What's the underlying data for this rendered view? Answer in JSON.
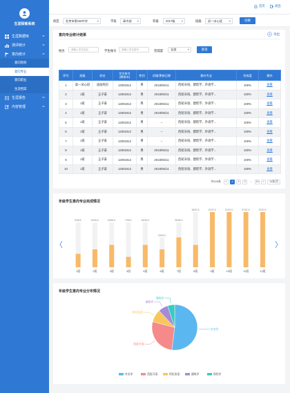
{
  "sidebar": {
    "title": "生涯探索系统",
    "menu": [
      {
        "label": "生涯数据库"
      },
      {
        "label": "测评统计"
      },
      {
        "label": "意向统计"
      }
    ],
    "submenu": [
      {
        "label": "意向院校"
      },
      {
        "label": "意向专业"
      },
      {
        "label": "意向职业"
      },
      {
        "label": "生涯档案"
      }
    ],
    "menu_bottom": [
      {
        "label": "生涯报告"
      },
      {
        "label": "内容管理"
      }
    ]
  },
  "topbar": {
    "home": "首页",
    "logout": "退出"
  },
  "filters": {
    "school_label": "校区",
    "school_value": "北京市第166中学",
    "section_label": "学段",
    "section_value": "高中部",
    "grade_label": "年级",
    "grade_value": "2017级",
    "class_label": "班级",
    "class_value": "初一冰心班",
    "switch_btn": "切换"
  },
  "table_card": {
    "title": "意向专业统计结果",
    "export": "导出",
    "name_label": "姓名",
    "name_placeholder": "请输入学生姓名",
    "id_label": "学生账号",
    "id_placeholder": "请输入学生账号",
    "status_label": "完成度",
    "status_value": "全部",
    "query_btn": "查询",
    "headers": [
      "序号",
      "班级",
      "姓名",
      "学生账号\n(教育ID)",
      "性别",
      "初填/更新日期",
      "意向专业",
      "完成度",
      "操作"
    ],
    "rows": [
      [
        "1",
        "高一冰心班",
        "迪丽热巴",
        "12001812",
        "男",
        "2018/05/11",
        "西班牙语、建筑学、外语学...",
        "100%",
        "查看"
      ],
      [
        "2",
        "1班",
        "王子安",
        "12001812",
        "男",
        "2018/05/11",
        "西班牙语、建筑学、外语学...",
        "100%",
        "查看"
      ],
      [
        "3",
        "1班",
        "王子安",
        "12001812",
        "男",
        "2018/05/11",
        "西班牙语、建筑学、外语学...",
        "100%",
        "查看"
      ],
      [
        "4",
        "1班",
        "王子安",
        "12001812",
        "男",
        "2018/05/11",
        "西班牙语、建筑学、外语学...",
        "100%",
        "查看"
      ],
      [
        "5",
        "1班",
        "王子安",
        "12001812",
        "男",
        "--",
        "西班牙语、建筑学、外语学...",
        "100%",
        "查看"
      ],
      [
        "6",
        "1班",
        "王子安",
        "12001812",
        "男",
        "--",
        "西班牙语、建筑学、外语学...",
        "100%",
        "查看"
      ],
      [
        "7",
        "1班",
        "王子安",
        "12001812",
        "男",
        "--",
        "西班牙语、建筑学、外语学...",
        "100%",
        "查看"
      ],
      [
        "8",
        "1班",
        "王子安",
        "12001812",
        "男",
        "2018/05/11",
        "西班牙语、建筑学、外语学...",
        "100%",
        "查看"
      ],
      [
        "9",
        "1班",
        "王子安",
        "12001812",
        "男",
        "2018/05/11",
        "西班牙语、建筑学、外语学...",
        "100%",
        "查看"
      ],
      [
        "10",
        "1班",
        "王子安",
        "12001812",
        "男",
        "2018/05/11",
        "西班牙语、建筑学、外语学...",
        "100%",
        "查看"
      ]
    ],
    "pager": {
      "total": "共328条",
      "prev": "<",
      "pages": [
        "1",
        "2",
        "3",
        "...",
        "10"
      ],
      "next": ">",
      "size": "10条/页"
    }
  },
  "bar_card": {
    "title": "年级学生意向专业完成情况"
  },
  "pie_card": {
    "title": "年级学生意向专业分布情况"
  },
  "colors": {
    "primary": "#2f78d4",
    "bar": "#f8b968",
    "bar_bg": "#f1f2f4"
  },
  "chart_data": [
    {
      "type": "bar",
      "title": "年级学生意向专业完成情况",
      "categories": [
        "1班",
        "2班",
        "3班",
        "4班",
        "5班",
        "6班",
        "7班",
        "8班",
        "9班",
        "10班",
        "11班",
        "12班"
      ],
      "labels": [
        "9/30人",
        "12/30人",
        "15/30人",
        "7/30人",
        "15/30人",
        "12/20人",
        "20/30人",
        "15/37人",
        "37/37人",
        "37/37人",
        "37/37人",
        "37/37人"
      ],
      "completed": [
        9,
        12,
        15,
        7,
        15,
        12,
        20,
        15,
        37,
        37,
        37,
        37
      ],
      "totals": [
        30,
        30,
        30,
        30,
        30,
        20,
        30,
        37,
        37,
        37,
        37,
        37
      ]
    },
    {
      "type": "pie",
      "title": "年级学生意向专业分布情况",
      "slices": [
        {
          "name": "外交学",
          "value": 52,
          "color": "#5bb7f0"
        },
        {
          "name": "西班牙语",
          "value": 27,
          "color": "#f58a8a"
        },
        {
          "name": "阿拉伯语",
          "value": 9,
          "color": "#f8c65a"
        },
        {
          "name": "建筑学",
          "value": 7,
          "color": "#a58ad8"
        },
        {
          "name": "保险学",
          "value": 5,
          "color": "#38cbc0"
        }
      ]
    }
  ]
}
